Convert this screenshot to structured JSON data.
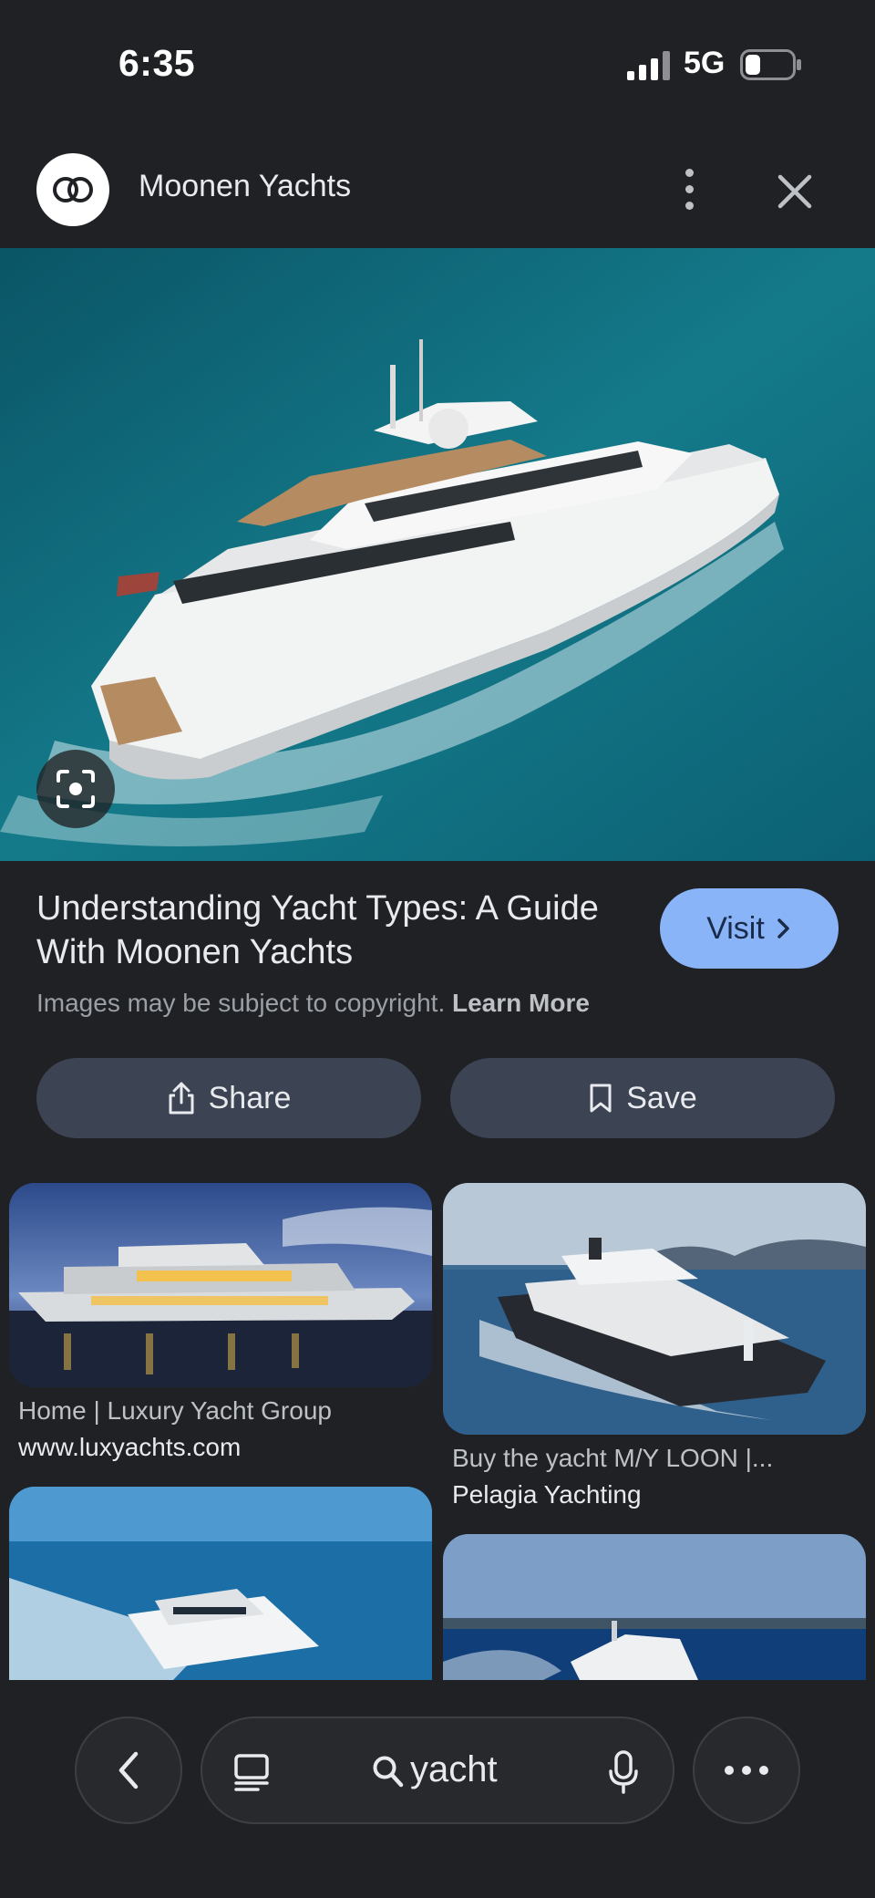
{
  "status_bar": {
    "time": "6:35",
    "network": "5G",
    "icons": [
      "cellular-signal-icon",
      "battery-icon"
    ]
  },
  "header": {
    "site_name": "Moonen Yachts",
    "icons": [
      "site-logo-icon",
      "more-vert-icon",
      "close-icon"
    ]
  },
  "hero": {
    "image_subject": "white superyacht on turquoise sea",
    "lens_icon": "lens-search-icon"
  },
  "info": {
    "title": "Understanding Yacht Types: A Guide With Moonen Yachts",
    "visit_label": "Visit",
    "copyright_text": "Images may be subject to copyright.",
    "learn_more": "Learn More"
  },
  "actions": {
    "share_label": "Share",
    "save_label": "Save"
  },
  "results": [
    {
      "title": "Home | Luxury Yacht Group",
      "source": "www.luxyachts.com"
    },
    {
      "title": "Buy the yacht M/Y LOON |...",
      "source": "Pelagia Yachting"
    },
    {
      "title": "",
      "source": ""
    },
    {
      "title": "",
      "source": ""
    }
  ],
  "bottom_bar": {
    "query": "yacht",
    "icons": [
      "back-icon",
      "tabs-icon",
      "search-icon",
      "mic-icon",
      "more-horiz-icon"
    ]
  },
  "colors": {
    "background": "#202124",
    "accent": "#8ab4f8",
    "button": "#3c4352"
  }
}
